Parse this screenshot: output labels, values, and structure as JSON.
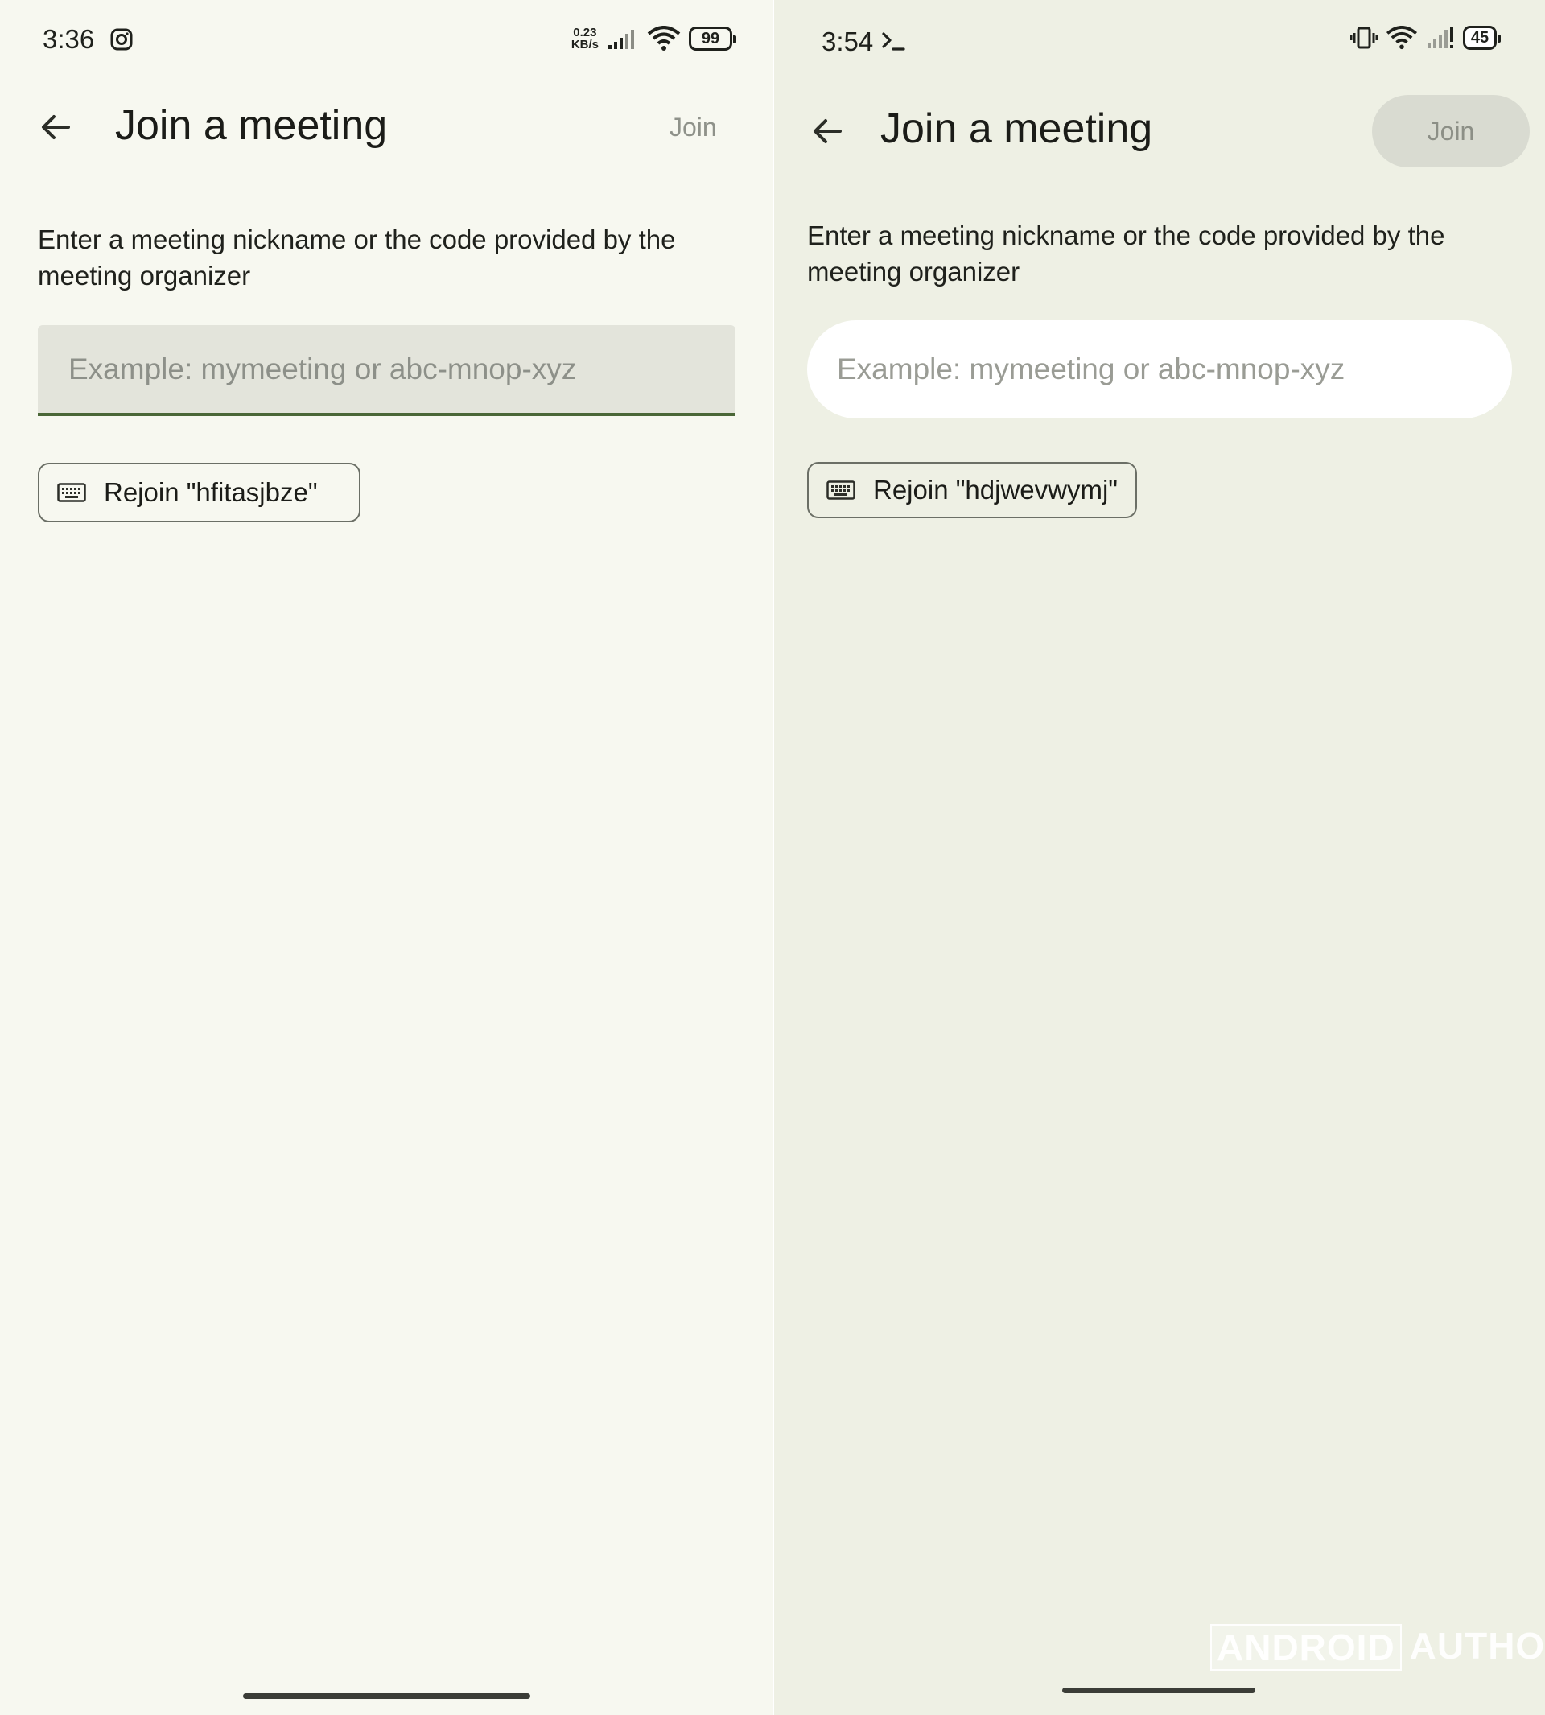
{
  "left": {
    "status": {
      "time": "3:36",
      "speed_top": "0.23",
      "speed_bottom": "KB/s",
      "battery": "99"
    },
    "title": "Join a meeting",
    "join_label": "Join",
    "description": "Enter a meeting nickname or the code provided by the meeting organizer",
    "input_placeholder": "Example: mymeeting or abc-mnop-xyz",
    "rejoin_label": "Rejoin \"hfitasjbze\""
  },
  "right": {
    "status": {
      "time": "3:54",
      "battery": "45"
    },
    "title": "Join a meeting",
    "join_label": "Join",
    "description": "Enter a meeting nickname or the code provided by the meeting organizer",
    "input_placeholder": "Example: mymeeting or abc-mnop-xyz",
    "rejoin_label": "Rejoin \"hdjwevwymj\"",
    "watermark": {
      "part1": "ANDROID",
      "part2": "AUTHORITY"
    }
  }
}
